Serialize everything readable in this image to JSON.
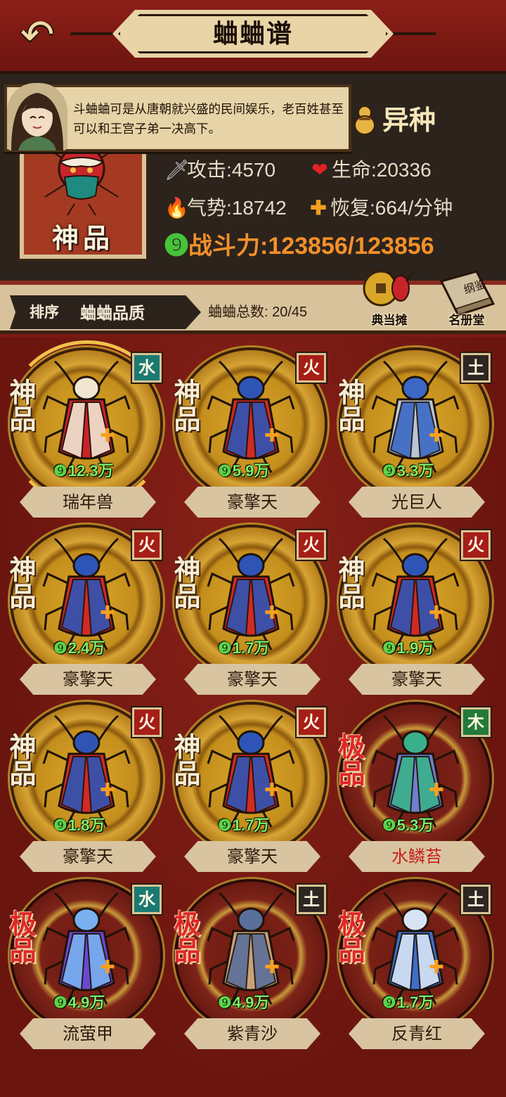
{
  "header": {
    "title": "蛐蛐谱",
    "back_icon": "back-arrow-icon"
  },
  "dialog": {
    "text": "斗蛐蛐可是从唐朝就兴盛的民间娱乐，老百姓甚至可以和王宫子弟一决高下。"
  },
  "featured": {
    "grade": "神品",
    "variety": "异种",
    "stats": {
      "attack": "攻击:4570",
      "life": "生命:20336",
      "momentum": "气势:18742",
      "recovery": "恢复:664/分钟",
      "power": "战斗力:123856/123856"
    }
  },
  "sortbar": {
    "sort_label": "排序",
    "sort_value": "蛐蛐品质",
    "total": "蛐蛐总数: 20/45"
  },
  "shops": [
    {
      "label": "典当摊",
      "icon": "coin-cricket-icon"
    },
    {
      "label": "名册堂",
      "icon": "book-icon"
    }
  ],
  "crickets": [
    {
      "name": "瑞年兽",
      "cp": "12.3万",
      "grade": "神品",
      "element": "水",
      "tier": "gold",
      "type": "water",
      "name_color": "dark",
      "body": "#c8242a",
      "accent": "#f0e6d2"
    },
    {
      "name": "豪擎天",
      "cp": "5.9万",
      "grade": "神品",
      "element": "火",
      "tier": "gold",
      "type": "fire",
      "name_color": "dark",
      "body": "#d12a24",
      "accent": "#2e55b5"
    },
    {
      "name": "光巨人",
      "cp": "3.3万",
      "grade": "神品",
      "element": "土",
      "tier": "gold",
      "type": "earth",
      "name_color": "dark",
      "body": "#b8c6d8",
      "accent": "#3a68c4"
    },
    {
      "name": "豪擎天",
      "cp": "2.4万",
      "grade": "神品",
      "element": "火",
      "tier": "gold",
      "type": "fire",
      "name_color": "dark",
      "body": "#d12a24",
      "accent": "#2e55b5"
    },
    {
      "name": "豪擎天",
      "cp": "1.7万",
      "grade": "神品",
      "element": "火",
      "tier": "gold",
      "type": "fire",
      "name_color": "dark",
      "body": "#d12a24",
      "accent": "#2e55b5"
    },
    {
      "name": "豪擎天",
      "cp": "1.9万",
      "grade": "神品",
      "element": "火",
      "tier": "gold",
      "type": "fire",
      "name_color": "dark",
      "body": "#d12a24",
      "accent": "#2e55b5"
    },
    {
      "name": "豪擎天",
      "cp": "1.8万",
      "grade": "神品",
      "element": "火",
      "tier": "gold",
      "type": "fire",
      "name_color": "dark",
      "body": "#d12a24",
      "accent": "#2e55b5"
    },
    {
      "name": "豪擎天",
      "cp": "1.7万",
      "grade": "神品",
      "element": "火",
      "tier": "gold",
      "type": "fire",
      "name_color": "dark",
      "body": "#d12a24",
      "accent": "#2e55b5"
    },
    {
      "name": "水鳞苔",
      "cp": "5.3万",
      "grade": "极品",
      "element": "木",
      "tier": "red",
      "type": "wood",
      "name_color": "red",
      "body": "#6f7fd0",
      "accent": "#3ab08a"
    },
    {
      "name": "流萤甲",
      "cp": "4.9万",
      "grade": "极品",
      "element": "水",
      "tier": "red",
      "type": "water",
      "name_color": "dark",
      "body": "#6a4ad0",
      "accent": "#7ab0f0"
    },
    {
      "name": "紫青沙",
      "cp": "4.9万",
      "grade": "极品",
      "element": "土",
      "tier": "red",
      "type": "earth",
      "name_color": "dark",
      "body": "#c8a27a",
      "accent": "#5a6f9a"
    },
    {
      "name": "反青红",
      "cp": "1.7万",
      "grade": "极品",
      "element": "土",
      "tier": "red",
      "type": "earth",
      "name_color": "dark",
      "body": "#3e6ec8",
      "accent": "#d8e4f6"
    }
  ]
}
